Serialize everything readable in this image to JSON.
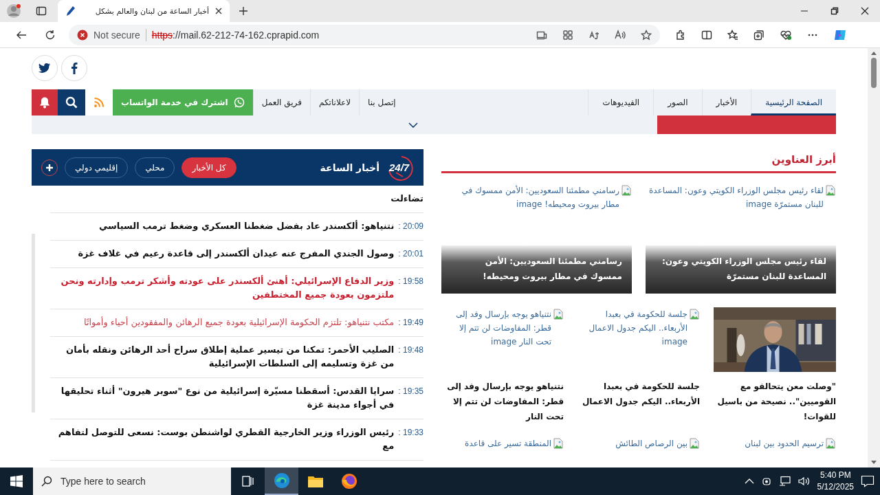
{
  "browser": {
    "tab_title": "أخبار الساعة من لبنان والعالم بشكل",
    "security": "Not secure",
    "url_scheme": "https",
    "url_rest": "://mail.62-212-74-162.cprapid.com"
  },
  "nav": {
    "items": [
      {
        "label": "الصفحة الرئيسية",
        "selected": true
      },
      {
        "label": "الأخبار",
        "selected": false
      },
      {
        "label": "الصور",
        "selected": false
      },
      {
        "label": "الفيديوهات",
        "selected": false
      }
    ],
    "links": [
      "إتصل بنا",
      "لاعلاناتكم",
      "فريق العمل"
    ],
    "whatsapp": "اشترك في خدمة الواتساب"
  },
  "live_news": {
    "logo": "24/7",
    "title": "أخبار الساعة",
    "filters": [
      {
        "label": "كل الأخبار",
        "selected": true
      },
      {
        "label": "محلي",
        "selected": false
      },
      {
        "label": "إقليمي دولي",
        "selected": false
      }
    ],
    "items": [
      {
        "kind": "normal",
        "text": "تضاءلت"
      },
      {
        "kind": "normal",
        "time": "20:09 :",
        "text": "نتنياهو: ألكسندر عاد بفضل ضغطنا العسكري وضغط ترمب السياسي"
      },
      {
        "kind": "normal",
        "time": "20:01 :",
        "text": "وصول الجندي المفرج عنه عيدان ألكسندر إلى قاعدة رعيم في غلاف غزة"
      },
      {
        "kind": "urgent",
        "time": "19:58 :",
        "text": "وزير الدفاع الإسرائيلي: أهنئ ألكسندر على عودته وأشكر ترمب وإدارته ونحن ملتزمون بعودة جميع المختطفين"
      },
      {
        "kind": "alert",
        "time": "19:49 :",
        "text": "مكتب نتنياهو: تلتزم الحكومة الإسرائيلية بعودة جميع الرهائن والمفقودين أحياء وأمواتًا"
      },
      {
        "kind": "normal",
        "time": "19:48 :",
        "text": "الصليب الأحمر: تمكنا من تيسير عملية إطلاق سراح أحد الرهائن ونقله بأمان من غزة وتسليمه إلى السلطات الإسرائيلية"
      },
      {
        "kind": "normal",
        "time": "19:35 :",
        "text": "سرايا القدس: أسقطنا مسيّرة إسرائيلية من نوع \"سوبر هيرون\" أثناء تحليقها في أجواء مدينة غزة"
      },
      {
        "kind": "normal",
        "time": "19:33 :",
        "text": "رئيس الوزراء وزير الخارجية القطري لواشنطن بوست: نسعى للتوصل لتفاهم مع"
      }
    ]
  },
  "headlines": {
    "title": "أبرز العناوين",
    "featured": [
      {
        "alt": "لقاء رئيس مجلس الوزراء الكويتي وعون: المساعدة للبنان مستمرّة image",
        "caption": "لقاء رئيس مجلس الوزراء الكويتي وعون: المساعدة للبنان مستمرّة"
      },
      {
        "alt": "رسامني مطمئنا السعوديين: الأمن ممسوك في مطار بيروت ومحيطه! image",
        "caption": "رسامني مطمئنا السعوديين: الأمن ممسوك في مطار بيروت ومحيطه!"
      }
    ],
    "cards": [
      {
        "kind": "picture",
        "caption": "\"وصلت معن يتحالفو مع القوميين\".. نصيحة من باسيل للقوات!"
      },
      {
        "kind": "broken",
        "alt": "جلسة للحكومة في بعبدا الأربعاء.. اليكم جدول الاعمال image",
        "caption": "جلسة للحكومة في بعبدا الأربعاء.. اليكم جدول الاعمال"
      },
      {
        "kind": "broken",
        "alt": "نتنياهو يوجه بإرسال وفد إلى قطر: المفاوضات لن تتم إلا تحت النار image",
        "caption": "نتنياهو يوجه بإرسال وفد إلى قطر: المفاوضات لن تتم إلا تحت النار"
      }
    ],
    "more": [
      "ترسيم الحدود بين لبنان",
      "بين الرصاص الطائش",
      "المنطقة تسير على قاعدة"
    ]
  },
  "taskbar": {
    "search_placeholder": "Type here to search",
    "time": "5:40 PM",
    "date": "5/12/2025"
  }
}
